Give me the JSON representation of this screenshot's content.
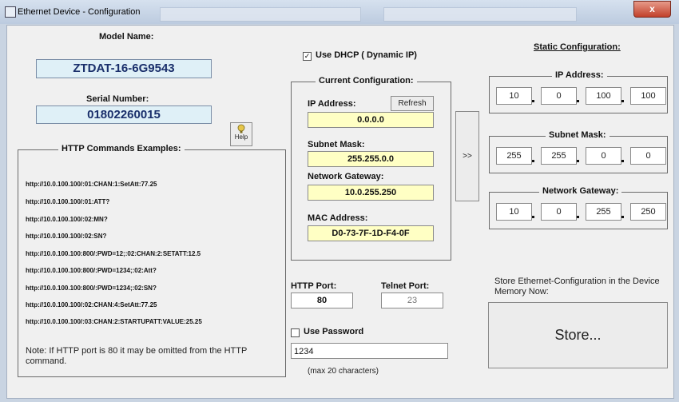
{
  "window": {
    "title": "Ethernet Device - Configuration",
    "close_label": "x"
  },
  "model": {
    "label": "Model Name:",
    "value": "ZTDAT-16-6G9543"
  },
  "serial": {
    "label": "Serial Number:",
    "value": "01802260015"
  },
  "help": {
    "label": "Help"
  },
  "http_examples": {
    "title": "HTTP Commands Examples:",
    "commands": [
      "http://10.0.100.100/:01:CHAN:1:SetAtt:77.25",
      "http://10.0.100.100/:01:ATT?",
      "http://10.0.100.100/:02:MN?",
      "http://10.0.100.100/:02:SN?",
      "http://10.0.100.100:800/:PWD=12;:02:CHAN:2:SETATT:12.5",
      "http://10.0.100.100:800/:PWD=1234;:02:Att?",
      "http://10.0.100.100:800/:PWD=1234;:02:SN?",
      "http://10.0.100.100/:02:CHAN:4:SetAtt:77.25",
      "http://10.0.100.100/:03:CHAN:2:STARTUPATT:VALUE:25.25"
    ],
    "note": "Note:  If  HTTP port is 80 it may be omitted from the HTTP command."
  },
  "dhcp": {
    "label": "Use DHCP ( Dynamic IP)",
    "checked": true
  },
  "current": {
    "title": "Current Configuration:",
    "ip_label": "IP Address:",
    "ip": "0.0.0.0",
    "refresh_label": "Refresh",
    "subnet_label": "Subnet Mask:",
    "subnet": "255.255.0.0",
    "gateway_label": "Network Gateway:",
    "gateway": "10.0.255.250",
    "mac_label": "MAC Address:",
    "mac": "D0-73-7F-1D-F4-0F"
  },
  "copy_button": ">>",
  "http_port": {
    "label": "HTTP Port:",
    "value": "80"
  },
  "telnet_port": {
    "label": "Telnet Port:",
    "value": "23"
  },
  "password": {
    "label": "Use Password",
    "checked": false,
    "value": "1234",
    "hint": "(max 20 characters)"
  },
  "static": {
    "title": "Static Configuration:",
    "ip_title": "IP Address:",
    "ip": [
      "10",
      "0",
      "100",
      "100"
    ],
    "subnet_title": "Subnet Mask:",
    "subnet": [
      "255",
      "255",
      "0",
      "0"
    ],
    "gateway_title": "Network Gateway:",
    "gateway": [
      "10",
      "0",
      "255",
      "250"
    ]
  },
  "store": {
    "text": "Store Ethernet-Configuration in the Device Memory Now:",
    "button": "Store..."
  }
}
